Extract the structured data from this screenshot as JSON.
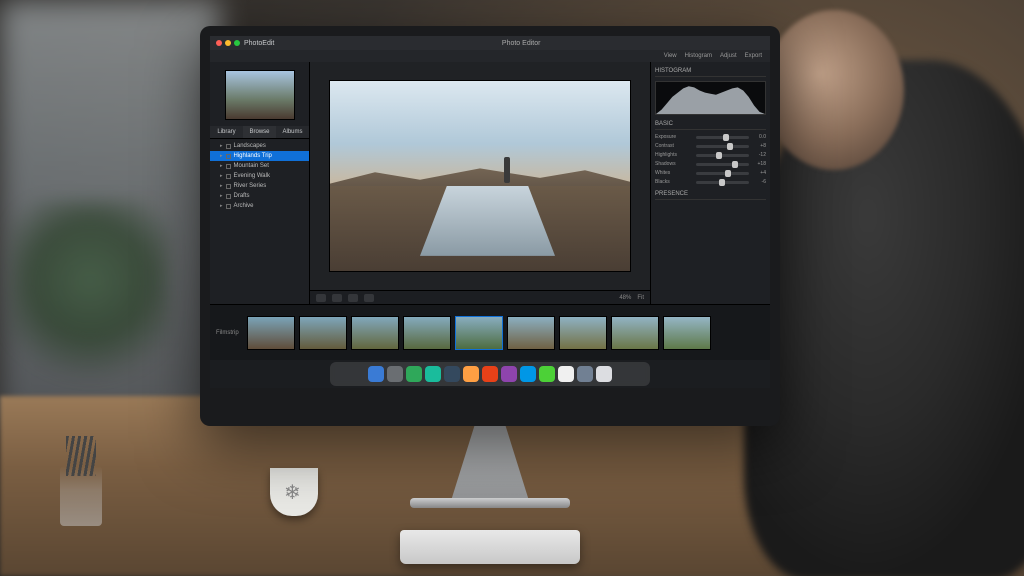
{
  "window": {
    "title": "Photo Editor",
    "app_label": "PhotoEdit"
  },
  "traffic_colors": {
    "close": "#ff5f57",
    "min": "#febc2e",
    "max": "#28c840"
  },
  "topbar": {
    "view_label": "View",
    "histogram_label": "Histogram",
    "adjust_label": "Adjust",
    "export_label": "Export"
  },
  "sidebar": {
    "tabs": [
      {
        "label": "Library",
        "active": false
      },
      {
        "label": "Browse",
        "active": true
      },
      {
        "label": "Albums",
        "active": false
      }
    ],
    "items": [
      {
        "label": "Landscapes",
        "selected": false
      },
      {
        "label": "Highlands Trip",
        "selected": true
      },
      {
        "label": "Mountain Set",
        "selected": false
      },
      {
        "label": "Evening Walk",
        "selected": false
      },
      {
        "label": "River Series",
        "selected": false
      },
      {
        "label": "Drafts",
        "selected": false
      },
      {
        "label": "Archive",
        "selected": false
      }
    ]
  },
  "canvas": {
    "zoom": "48%",
    "fit_label": "Fit"
  },
  "adjust": {
    "header": "Basic",
    "sliders": [
      {
        "label": "Exposure",
        "value": "0.0",
        "pos": 50
      },
      {
        "label": "Contrast",
        "value": "+8",
        "pos": 58
      },
      {
        "label": "Highlights",
        "value": "-12",
        "pos": 38
      },
      {
        "label": "Shadows",
        "value": "+18",
        "pos": 68
      },
      {
        "label": "Whites",
        "value": "+4",
        "pos": 54
      },
      {
        "label": "Blacks",
        "value": "-6",
        "pos": 44
      }
    ],
    "presence_header": "Presence"
  },
  "histogram": {
    "label": "Histogram"
  },
  "filmstrip": {
    "label": "Filmstrip",
    "count": 9,
    "selected_index": 4
  },
  "dock_colors": [
    "#3a7bd5",
    "#6a6e72",
    "#2fa85a",
    "#1abc9c",
    "#34495e",
    "#ff9f43",
    "#e84118",
    "#8e44ad",
    "#0097e6",
    "#4cd137",
    "#f0f0f0",
    "#718093",
    "#dcdde1"
  ]
}
